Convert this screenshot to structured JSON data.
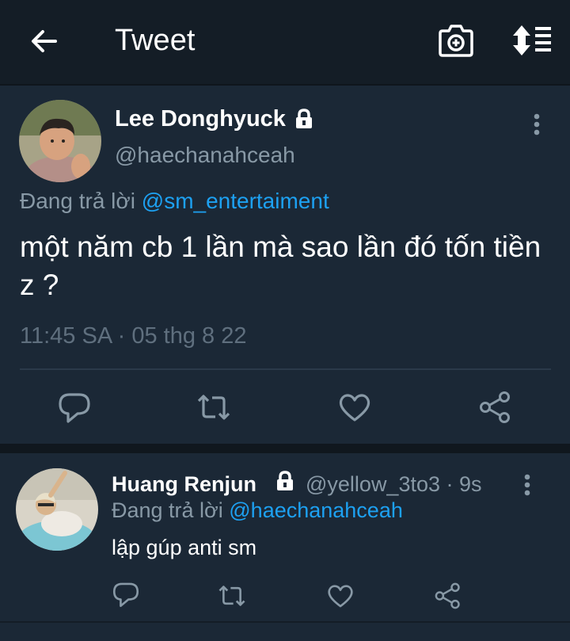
{
  "header": {
    "title": "Tweet",
    "back_icon": "arrow-left-icon",
    "camera_icon": "camera-plus-icon",
    "sort_icon": "sort-list-icon"
  },
  "tweet": {
    "display_name": "Lee Donghyuck",
    "handle": "@haechanahceah",
    "replying_prefix": "Đang trả lời ",
    "replying_to": "@sm_entertaiment",
    "text": "một năm cb 1 lần mà sao lần đó tốn tiền z ?",
    "timestamp": "11:45 SA · 05 thg 8 22",
    "protected": true
  },
  "reply": {
    "display_name": "Huang Renjun",
    "handle_time": "@yellow_3to3 · 9s",
    "replying_prefix": "Đang trả lời ",
    "replying_to": "@haechanahceah",
    "text": "lập gúp anti sm",
    "protected": true
  },
  "colors": {
    "background": "#141d26",
    "card": "#1b2836",
    "accent": "#1da1f2",
    "muted": "#8899a6"
  }
}
